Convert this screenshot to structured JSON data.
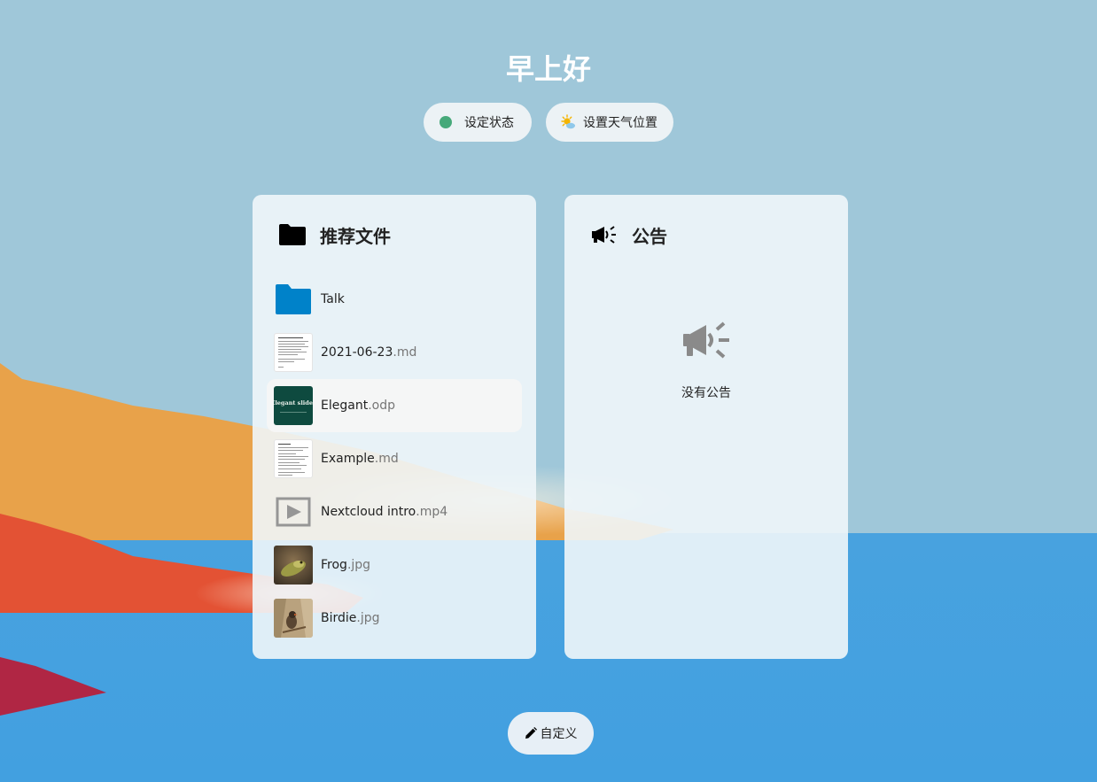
{
  "greeting": "早上好",
  "status_actions": {
    "set_status": "设定状态",
    "set_weather": "设置天气位置"
  },
  "recommended_files": {
    "title": "推荐文件",
    "items": [
      {
        "name": "Talk",
        "ext": "",
        "type": "folder",
        "icon": "folder-icon"
      },
      {
        "name": "2021-06-23",
        "ext": ".md",
        "type": "document",
        "icon": "document-thumbnail"
      },
      {
        "name": "Elegant",
        "ext": ".odp",
        "type": "presentation",
        "icon": "presentation-thumbnail",
        "thumb_text": "Elegant slides"
      },
      {
        "name": "Example",
        "ext": ".md",
        "type": "document",
        "icon": "document-thumbnail"
      },
      {
        "name": "Nextcloud intro",
        "ext": ".mp4",
        "type": "video",
        "icon": "video-icon"
      },
      {
        "name": "Frog",
        "ext": ".jpg",
        "type": "image",
        "icon": "image-thumbnail"
      },
      {
        "name": "Birdie",
        "ext": ".jpg",
        "type": "image",
        "icon": "image-thumbnail"
      }
    ]
  },
  "announcements": {
    "title": "公告",
    "empty_text": "没有公告"
  },
  "customize_label": "自定义",
  "colors": {
    "sky": "#9fc7d9",
    "water": "#44a0df",
    "hill_orange": "#e8a24a",
    "hill_red": "#e35234",
    "hill_crimson": "#b02644",
    "folder_blue": "#0082c9",
    "status_online": "#46a97a",
    "presentation_green": "#0e4a3f"
  }
}
